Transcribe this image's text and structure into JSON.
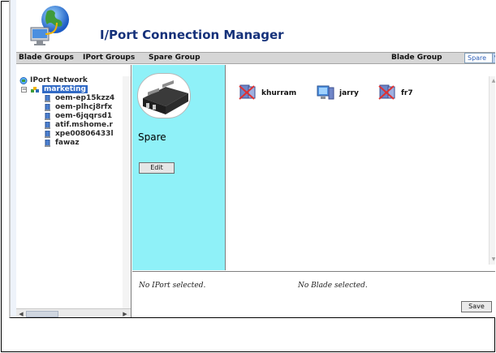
{
  "app": {
    "title": "I/Port Connection Manager"
  },
  "menu": {
    "items": [
      "Blade Groups",
      "IPort Groups",
      "Spare Group"
    ],
    "blade_group_label": "Blade Group",
    "blade_group_value": "Spare"
  },
  "tree": {
    "root": "IPort Network",
    "group": "marketing",
    "items": [
      "oem-ep15kzz4",
      "oem-plhcj8rfx",
      "oem-6jqqrsd1",
      "atif.mshome.r",
      "xpe00806433l",
      "fawaz"
    ]
  },
  "group_panel": {
    "name": "Spare",
    "edit_label": "Edit"
  },
  "blades": [
    {
      "label": "khurram",
      "icon": "blade-server-disabled-icon"
    },
    {
      "label": "jarry",
      "icon": "blade-server-icon"
    },
    {
      "label": "fr7",
      "icon": "blade-server-disabled-icon"
    }
  ],
  "status": {
    "iport": "No IPort selected.",
    "blade": "No Blade selected.",
    "save_label": "Save"
  },
  "colors": {
    "accent": "#15317a",
    "group_panel_bg": "#8ff1f8",
    "selection": "#316ac5"
  }
}
